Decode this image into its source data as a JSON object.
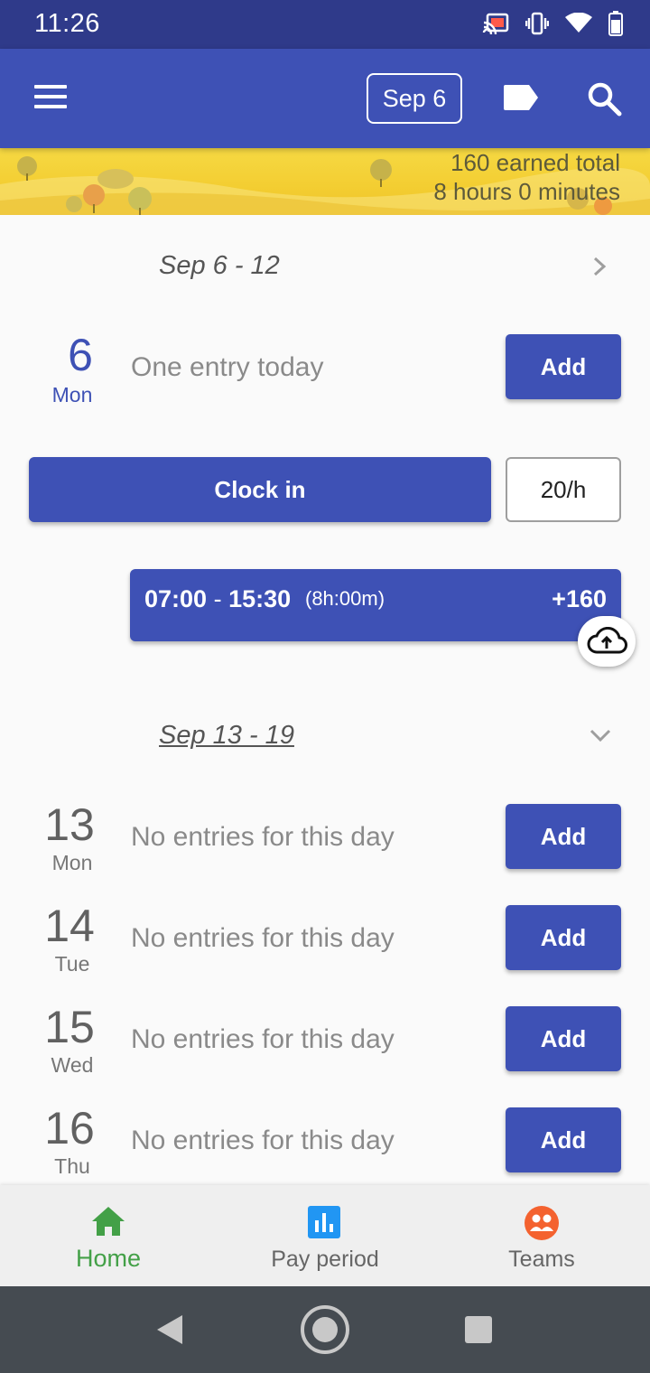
{
  "status_bar": {
    "time": "11:26"
  },
  "app_bar": {
    "date_chip": "Sep 6"
  },
  "banner": {
    "line1": "160 earned total",
    "line2": "8 hours 0 minutes"
  },
  "weeks": [
    {
      "label": "Sep 6 - 12"
    },
    {
      "label": "Sep 13 - 19"
    }
  ],
  "today": {
    "day_num": "6",
    "day_name": "Mon",
    "summary": "One entry today",
    "add_label": "Add"
  },
  "clock": {
    "clock_in_label": "Clock in",
    "rate": "20/h"
  },
  "entry": {
    "start": "07:00",
    "separator": "-",
    "end": "15:30",
    "duration": "(8h:00m)",
    "earned": "+160"
  },
  "days": [
    {
      "num": "13",
      "name": "Mon",
      "text": "No entries for this day",
      "add": "Add"
    },
    {
      "num": "14",
      "name": "Tue",
      "text": "No entries for this day",
      "add": "Add"
    },
    {
      "num": "15",
      "name": "Wed",
      "text": "No entries for this day",
      "add": "Add"
    },
    {
      "num": "16",
      "name": "Thu",
      "text": "No entries for this day",
      "add": "Add"
    }
  ],
  "bottom_nav": [
    {
      "label": "Home",
      "icon": "home-icon",
      "active": true
    },
    {
      "label": "Pay period",
      "icon": "bar-chart-icon",
      "active": false
    },
    {
      "label": "Teams",
      "icon": "teams-icon",
      "active": false
    }
  ],
  "colors": {
    "primary": "#3e51b5",
    "status_bar": "#2f3a8a",
    "active_nav": "#43a047",
    "teams_icon": "#f4622f",
    "pay_icon": "#2196f3"
  }
}
